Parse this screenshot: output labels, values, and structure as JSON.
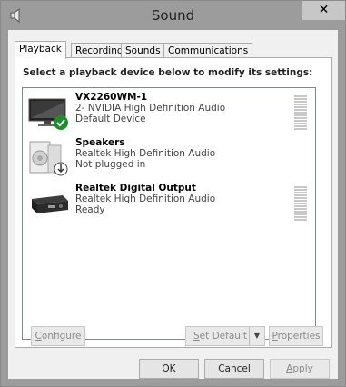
{
  "window": {
    "title": "Sound",
    "close_label": "✕"
  },
  "tabs": [
    {
      "label": "Playback",
      "active": true
    },
    {
      "label": "Recording"
    },
    {
      "label": "Sounds"
    },
    {
      "label": "Communications"
    }
  ],
  "instruction": "Select a playback device below to modify its settings:",
  "devices": [
    {
      "name": "VX2260WM-1",
      "line2": "2- NVIDIA High Definition Audio",
      "line3": "Default Device",
      "icon": "monitor-speaker-icon",
      "status_icon": "default-checkmark-icon"
    },
    {
      "name": "Speakers",
      "line2": "Realtek High Definition Audio",
      "line3": "Not plugged in",
      "icon": "speakers-icon",
      "status_icon": "unplugged-arrow-icon"
    },
    {
      "name": "Realtek Digital Output",
      "line2": "Realtek High Definition Audio",
      "line3": "Ready",
      "icon": "digital-output-icon"
    }
  ],
  "buttons": {
    "configure": {
      "acc": "C",
      "rest": "onfigure"
    },
    "set_default": {
      "acc": "S",
      "rest": "et Default"
    },
    "properties": {
      "acc": "P",
      "rest": "roperties"
    },
    "ok": "OK",
    "cancel": "Cancel",
    "apply": {
      "acc": "A",
      "rest": "pply"
    }
  },
  "colors": {
    "frame": "#9c9c9c",
    "client": "#f0f0f0",
    "check_green": "#1a8f2a"
  }
}
